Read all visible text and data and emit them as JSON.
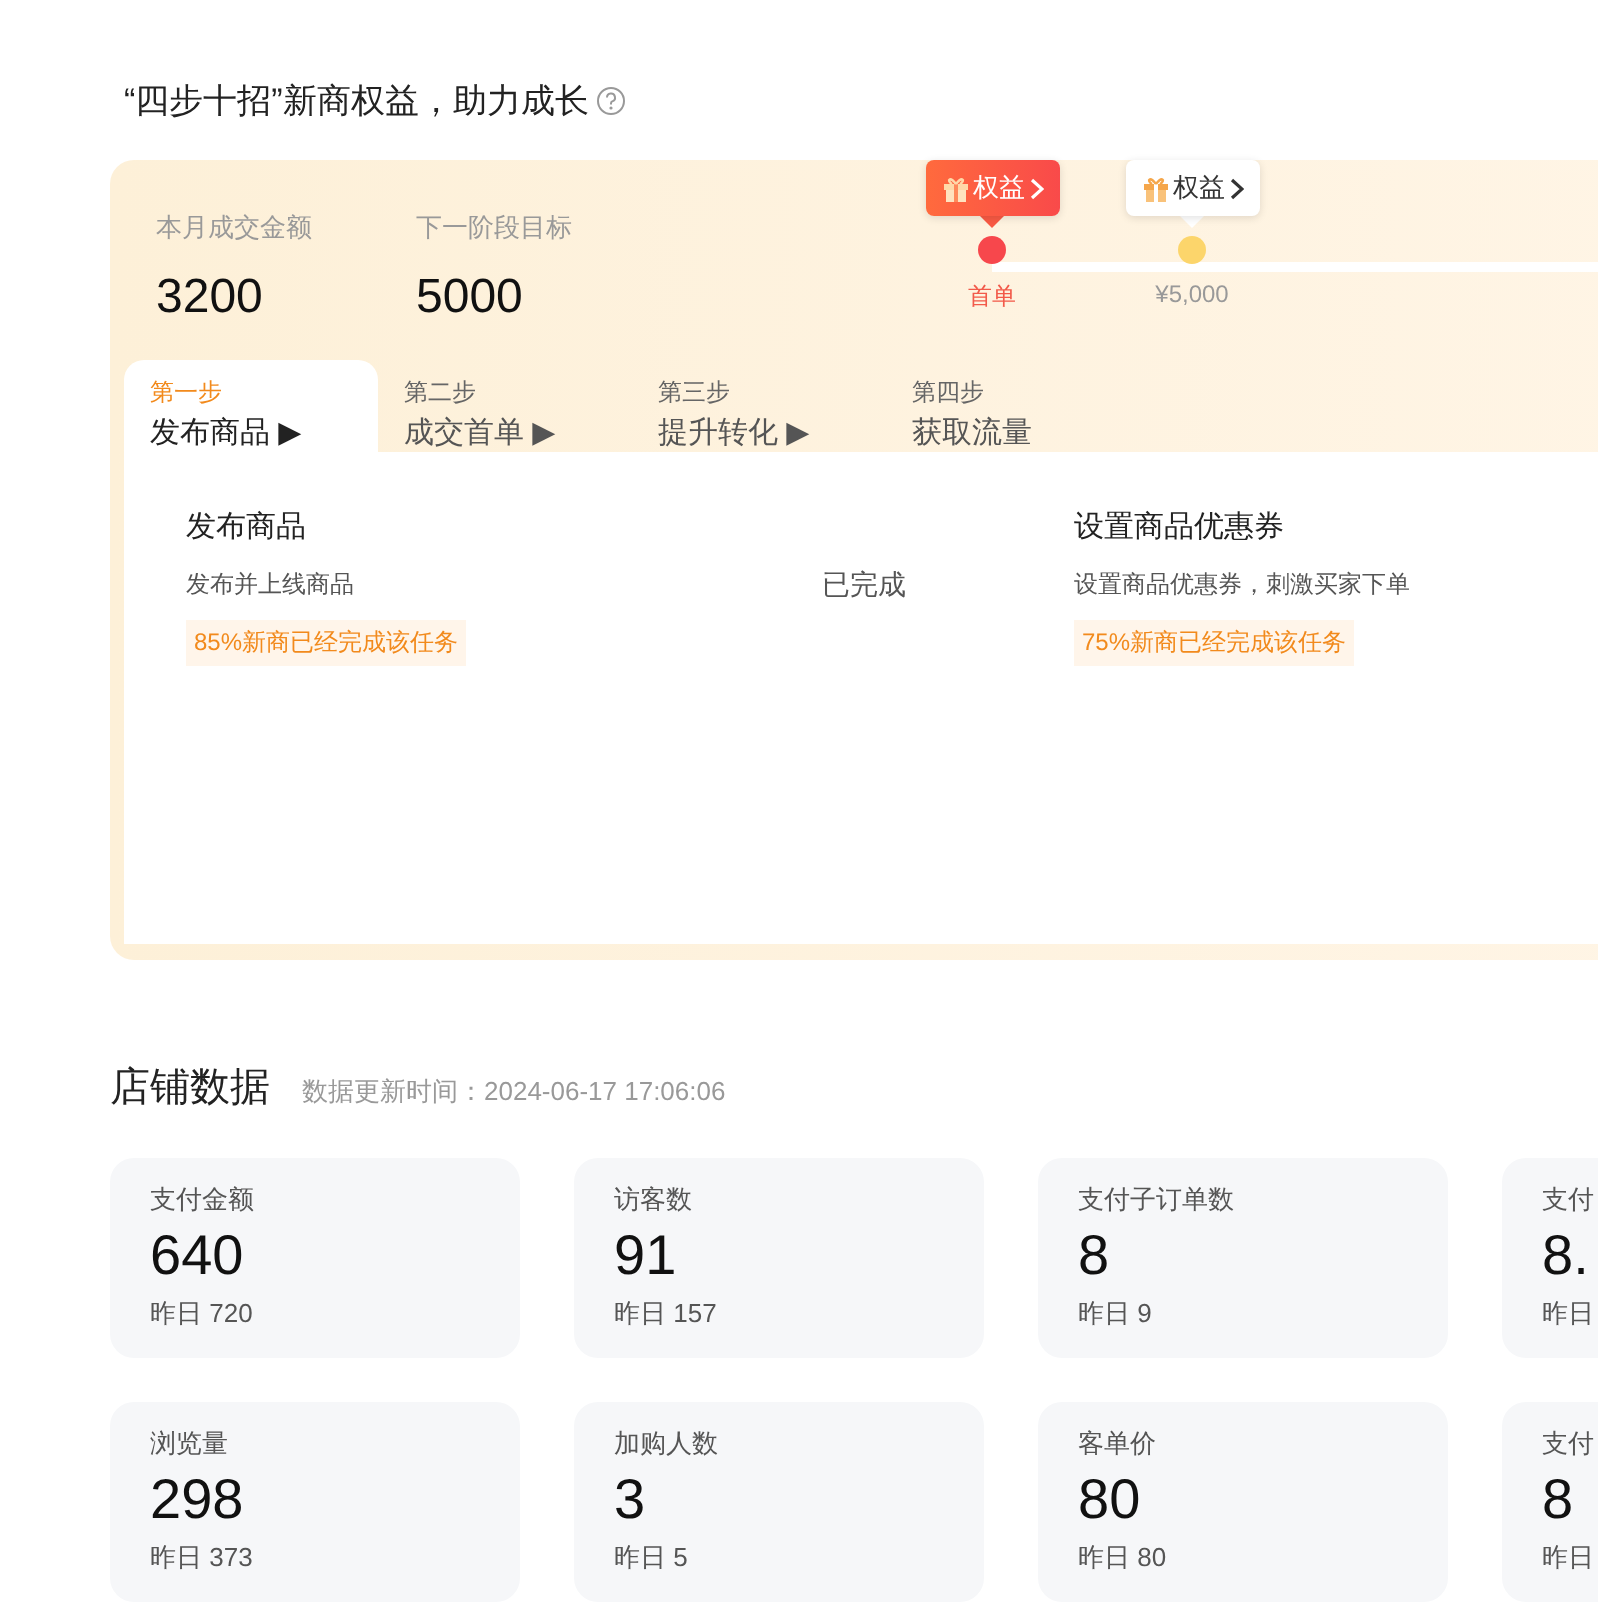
{
  "title": "“四步十招”新商权益，助力成长",
  "progress": {
    "metrics": [
      {
        "label": "本月成交金额",
        "value": "3200"
      },
      {
        "label": "下一阶段目标",
        "value": "5000"
      }
    ],
    "milestones": [
      {
        "badge": "权益",
        "label": "首单",
        "reached": true
      },
      {
        "badge": "权益",
        "label": "¥5,000",
        "reached": false
      }
    ],
    "steps": [
      {
        "step": "第一步",
        "title": "发布商品",
        "arrow": "▶",
        "selected": true
      },
      {
        "step": "第二步",
        "title": "成交首单",
        "arrow": "▶",
        "selected": false
      },
      {
        "step": "第三步",
        "title": "提升转化",
        "arrow": "▶",
        "selected": false
      },
      {
        "step": "第四步",
        "title": "获取流量",
        "selected": false
      }
    ],
    "tasks": [
      {
        "title": "发布商品",
        "description": "发布并上线商品",
        "stat": "85%新商已经完成该任务",
        "status": "已完成"
      },
      {
        "title": "设置商品优惠券",
        "description": "设置商品优惠券，刺激买家下单",
        "stat": "75%新商已经完成该任务"
      }
    ]
  },
  "store_data": {
    "title": "店铺数据",
    "updated": "数据更新时间：2024-06-17 17:06:06",
    "cards": [
      {
        "label": "支付金额",
        "value": "640",
        "yesterday": "昨日 720"
      },
      {
        "label": "访客数",
        "value": "91",
        "yesterday": "昨日 157"
      },
      {
        "label": "支付子订单数",
        "value": "8",
        "yesterday": "昨日 9"
      },
      {
        "label": "支付",
        "value": "8.",
        "yesterday": "昨日"
      },
      {
        "label": "浏览量",
        "value": "298",
        "yesterday": "昨日 373"
      },
      {
        "label": "加购人数",
        "value": "3",
        "yesterday": "昨日 5"
      },
      {
        "label": "客单价",
        "value": "80",
        "yesterday": "昨日 80"
      },
      {
        "label": "支付",
        "value": "8",
        "yesterday": "昨日"
      }
    ]
  }
}
